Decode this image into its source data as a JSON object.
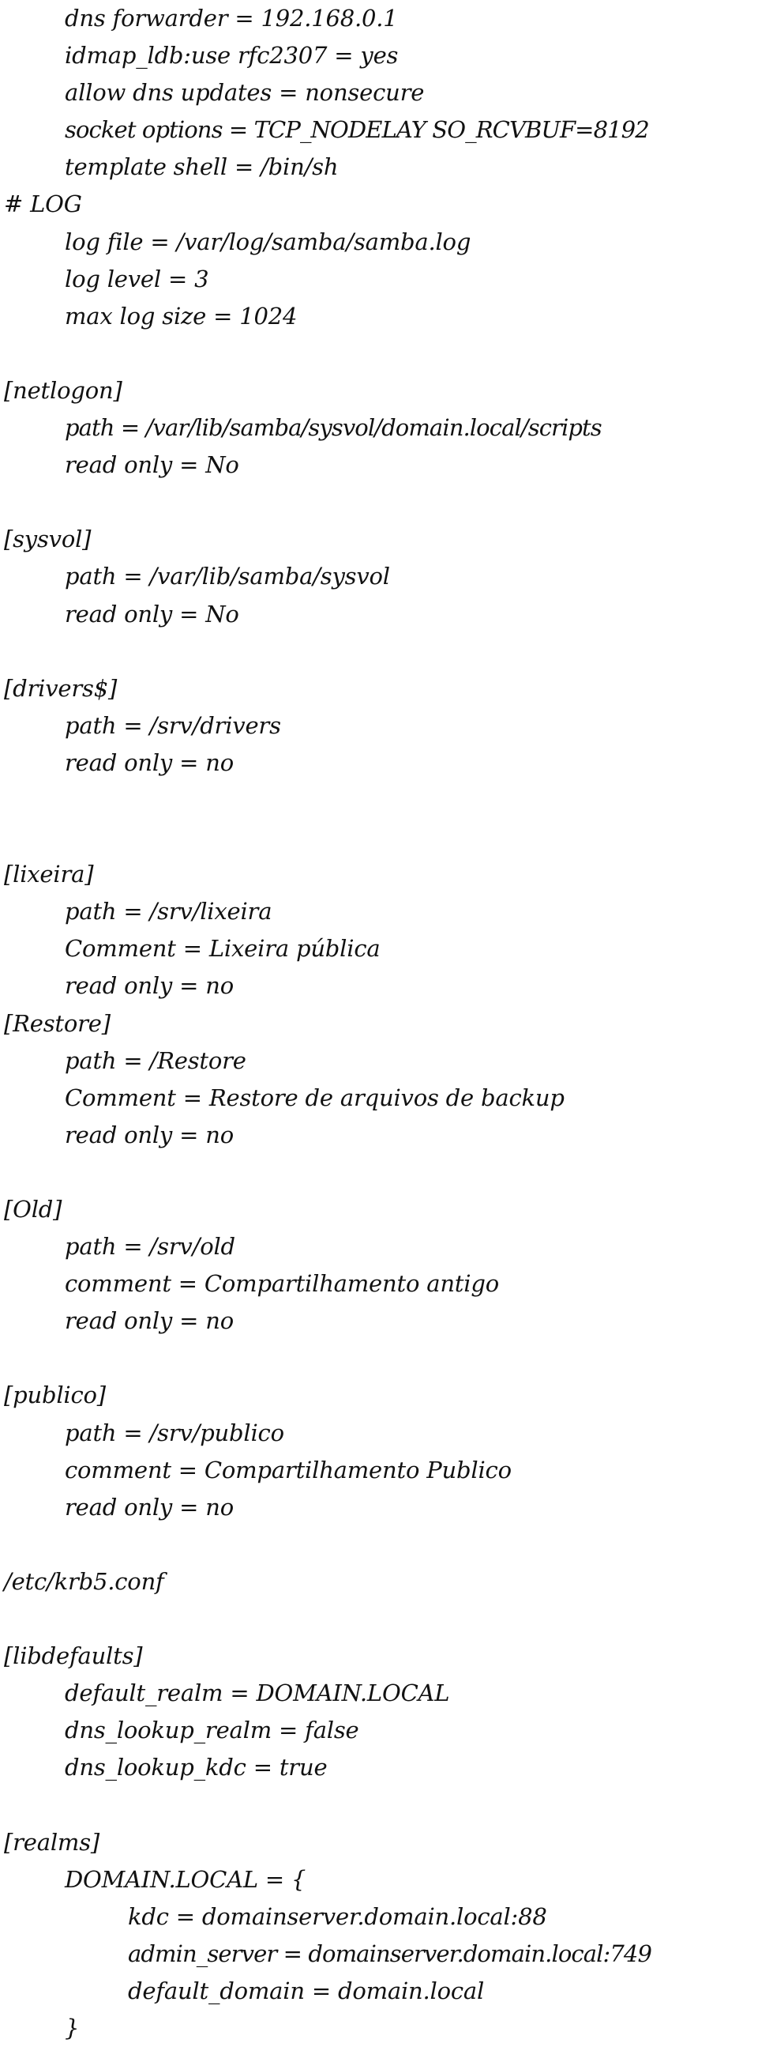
{
  "document": {
    "lines": [
      {
        "indent": 1,
        "text": "dns forwarder = 192.168.0.1"
      },
      {
        "indent": 1,
        "text": "idmap_ldb:use rfc2307 = yes"
      },
      {
        "indent": 1,
        "text": "allow dns updates = nonsecure"
      },
      {
        "indent": 1,
        "text": "socket options = TCP_NODELAY SO_RCVBUF=8192"
      },
      {
        "indent": 1,
        "text": "template shell = /bin/sh"
      },
      {
        "indent": 0,
        "text": "# LOG"
      },
      {
        "indent": 1,
        "text": "log file = /var/log/samba/samba.log"
      },
      {
        "indent": 1,
        "text": "log level = 3"
      },
      {
        "indent": 1,
        "text": "max log size = 1024"
      },
      {
        "indent": 0,
        "text": ""
      },
      {
        "indent": 0,
        "text": "[netlogon]"
      },
      {
        "indent": 1,
        "text": "path = /var/lib/samba/sysvol/domain.local/scripts"
      },
      {
        "indent": 1,
        "text": "read only = No"
      },
      {
        "indent": 0,
        "text": ""
      },
      {
        "indent": 0,
        "text": "[sysvol]"
      },
      {
        "indent": 1,
        "text": "path = /var/lib/samba/sysvol"
      },
      {
        "indent": 1,
        "text": "read only = No"
      },
      {
        "indent": 0,
        "text": ""
      },
      {
        "indent": 0,
        "text": "[drivers$]"
      },
      {
        "indent": 1,
        "text": "path = /srv/drivers"
      },
      {
        "indent": 1,
        "text": "read only = no"
      },
      {
        "indent": 0,
        "text": ""
      },
      {
        "indent": 0,
        "text": ""
      },
      {
        "indent": 0,
        "text": "[lixeira]"
      },
      {
        "indent": 1,
        "text": "path = /srv/lixeira"
      },
      {
        "indent": 1,
        "text": "Comment = Lixeira pública"
      },
      {
        "indent": 1,
        "text": "read only = no"
      },
      {
        "indent": 0,
        "text": "[Restore]"
      },
      {
        "indent": 1,
        "text": "path = /Restore"
      },
      {
        "indent": 1,
        "text": "Comment = Restore de arquivos de backup"
      },
      {
        "indent": 1,
        "text": "read only = no"
      },
      {
        "indent": 0,
        "text": ""
      },
      {
        "indent": 0,
        "text": "[Old]"
      },
      {
        "indent": 1,
        "text": "path = /srv/old"
      },
      {
        "indent": 1,
        "text": "comment = Compartilhamento antigo"
      },
      {
        "indent": 1,
        "text": "read only = no"
      },
      {
        "indent": 0,
        "text": ""
      },
      {
        "indent": 0,
        "text": "[publico]"
      },
      {
        "indent": 1,
        "text": "path = /srv/publico"
      },
      {
        "indent": 1,
        "text": "comment = Compartilhamento Publico"
      },
      {
        "indent": 1,
        "text": "read only = no"
      },
      {
        "indent": 0,
        "text": ""
      },
      {
        "indent": 0,
        "text": "/etc/krb5.conf"
      },
      {
        "indent": 0,
        "text": ""
      },
      {
        "indent": 0,
        "text": "[libdefaults]"
      },
      {
        "indent": 1,
        "text": "default_realm = DOMAIN.LOCAL"
      },
      {
        "indent": 1,
        "text": "dns_lookup_realm = false"
      },
      {
        "indent": 1,
        "text": "dns_lookup_kdc = true"
      },
      {
        "indent": 0,
        "text": ""
      },
      {
        "indent": 0,
        "text": "[realms]"
      },
      {
        "indent": 1,
        "text": "DOMAIN.LOCAL = {"
      },
      {
        "indent": 2,
        "text": "kdc = domainserver.domain.local:88"
      },
      {
        "indent": 2,
        "text": "admin_server = domainserver.domain.local:749"
      },
      {
        "indent": 2,
        "text": "default_domain = domain.local"
      },
      {
        "indent": 1,
        "text": "}"
      }
    ]
  }
}
